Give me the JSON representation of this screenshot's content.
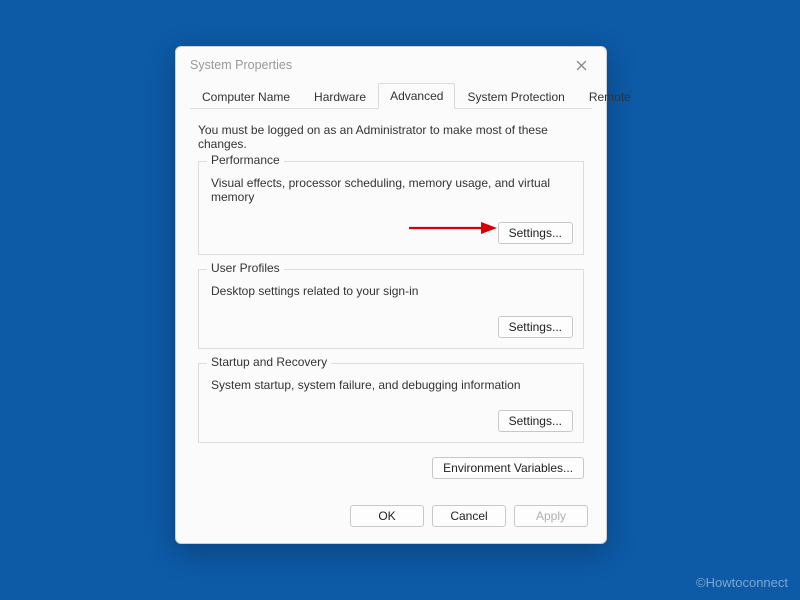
{
  "window": {
    "title": "System Properties"
  },
  "tabs": {
    "computer_name": "Computer Name",
    "hardware": "Hardware",
    "advanced": "Advanced",
    "system_protection": "System Protection",
    "remote": "Remote"
  },
  "content": {
    "admin_notice": "You must be logged on as an Administrator to make most of these changes.",
    "performance": {
      "title": "Performance",
      "desc": "Visual effects, processor scheduling, memory usage, and virtual memory",
      "button": "Settings..."
    },
    "user_profiles": {
      "title": "User Profiles",
      "desc": "Desktop settings related to your sign-in",
      "button": "Settings..."
    },
    "startup_recovery": {
      "title": "Startup and Recovery",
      "desc": "System startup, system failure, and debugging information",
      "button": "Settings..."
    },
    "env_button": "Environment Variables..."
  },
  "footer": {
    "ok": "OK",
    "cancel": "Cancel",
    "apply": "Apply"
  },
  "watermark": "©Howtoconnect"
}
